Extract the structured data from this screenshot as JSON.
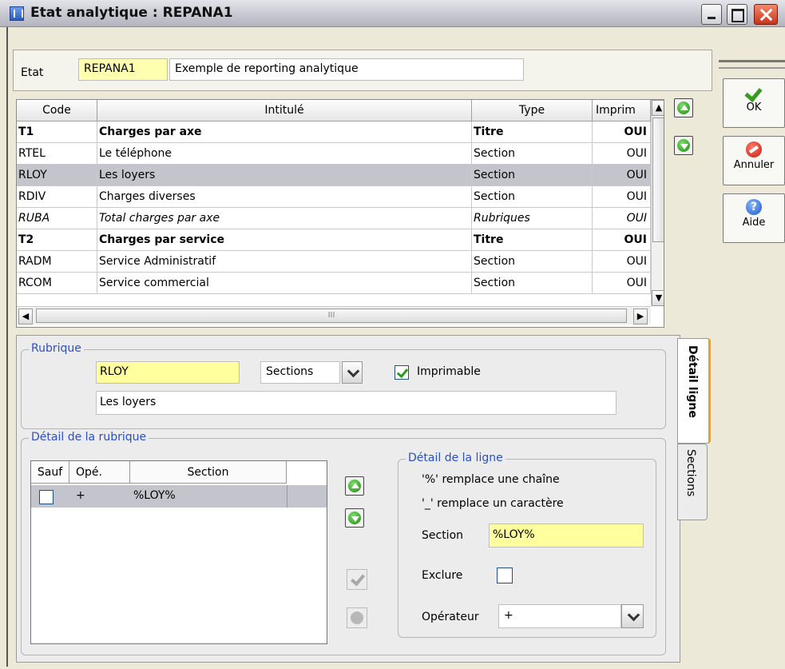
{
  "window": {
    "title": "Etat analytique : REPANA1"
  },
  "etat": {
    "label": "Etat",
    "code": "REPANA1",
    "description": "Exemple de reporting analytique"
  },
  "toolbar": {
    "ok": "OK",
    "cancel": "Annuler",
    "help": "Aide",
    "help_icon": "?"
  },
  "grid": {
    "headers": [
      "Code",
      "Intitulé",
      "Type",
      "Imprim"
    ],
    "rows": [
      {
        "code": "T1",
        "label": "Charges par axe",
        "type": "Titre",
        "print": "OUI",
        "style": "bold"
      },
      {
        "code": "RTEL",
        "label": "Le téléphone",
        "type": "Section",
        "print": "OUI",
        "style": "normal"
      },
      {
        "code": "RLOY",
        "label": "Les loyers",
        "type": "Section",
        "print": "OUI",
        "style": "selected"
      },
      {
        "code": "RDIV",
        "label": "Charges diverses",
        "type": "Section",
        "print": "OUI",
        "style": "normal"
      },
      {
        "code": "RUBA",
        "label": "Total charges par axe",
        "type": "Rubriques",
        "print": "OUI",
        "style": "italic"
      },
      {
        "code": "T2",
        "label": "Charges par service",
        "type": "Titre",
        "print": "OUI",
        "style": "bold"
      },
      {
        "code": "RADM",
        "label": "Service Administratif",
        "type": "Section",
        "print": "OUI",
        "style": "normal"
      },
      {
        "code": "RCOM",
        "label": "Service commercial",
        "type": "Section",
        "print": "OUI",
        "style": "normal"
      }
    ],
    "hscroll_mark": "III"
  },
  "rubrique": {
    "legend": "Rubrique",
    "code": "RLOY",
    "type": "Sections",
    "printable_label": "Imprimable",
    "printable": true,
    "label": "Les loyers"
  },
  "detail": {
    "legend": "Détail de la rubrique",
    "headers": [
      "Sauf",
      "Opé.",
      "Section"
    ],
    "rows": [
      {
        "sauf": false,
        "op": "+",
        "section": "%LOY%"
      }
    ]
  },
  "ligne": {
    "legend": "Détail de la ligne",
    "note1": "'%' remplace une chaîne",
    "note2": "'_' remplace un caractère",
    "section_label": "Section",
    "section_value": "%LOY%",
    "exclure_label": "Exclure",
    "operator_label": "Opérateur",
    "operator_value": "+"
  },
  "tabs": {
    "detail": "Détail ligne",
    "sections": "Sections"
  }
}
